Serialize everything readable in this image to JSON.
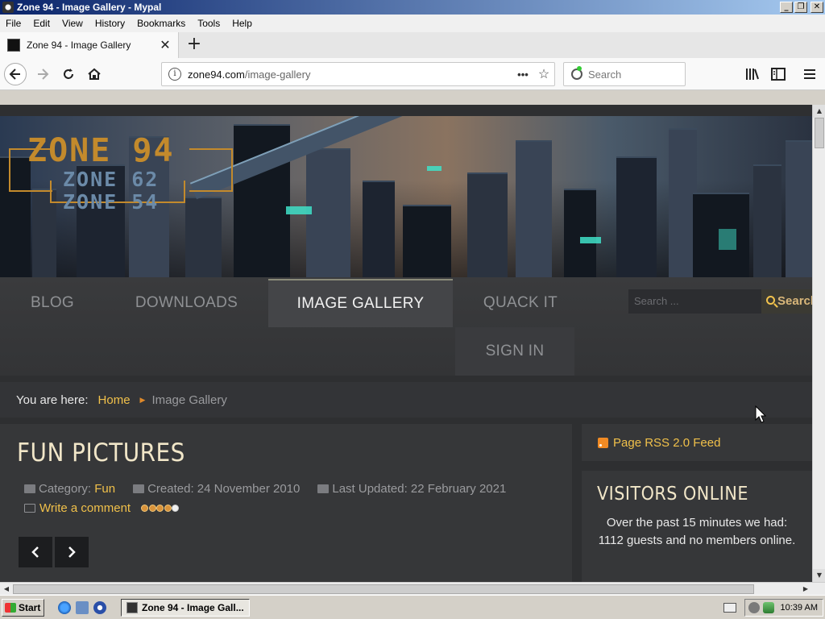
{
  "window": {
    "title": "Zone 94 - Image Gallery - Mypal",
    "buttons": [
      "_",
      "❐",
      "✕"
    ]
  },
  "menubar": {
    "items": [
      "File",
      "Edit",
      "View",
      "History",
      "Bookmarks",
      "Tools",
      "Help"
    ]
  },
  "tabs": {
    "active_title": "Zone 94 - Image Gallery",
    "close_glyph": "✕",
    "new_tab_glyph": "+"
  },
  "toolbar": {
    "url_host": "zone94.com",
    "url_path": "/image-gallery",
    "page_actions_glyph": "•••",
    "bookmark_glyph": "☆",
    "search_placeholder": "Search"
  },
  "site": {
    "logo": {
      "main": "ZONE 94",
      "sub1": "ZONE 62",
      "sub2": "ZONE 54"
    },
    "nav": {
      "items": [
        "BLOG",
        "DOWNLOADS",
        "IMAGE GALLERY",
        "QUACK IT",
        "SIGN IN"
      ],
      "active": "IMAGE GALLERY",
      "search_placeholder": "Search ...",
      "search_button": "Search"
    },
    "breadcrumb": {
      "label": "You are here:",
      "home": "Home",
      "current": "Image Gallery"
    },
    "article": {
      "title": "FUN PICTURES",
      "category_label": "Category:",
      "category_value": "Fun",
      "created": "Created: 24 November 2010",
      "updated": "Last Updated: 22 February 2021",
      "comment_link": "Write a comment",
      "rating": 4,
      "rating_max": 5,
      "prev_glyph": "‹",
      "next_glyph": "›"
    },
    "sidebar": {
      "rss_link": "Page RSS 2.0 Feed",
      "visitors_title": "VISITORS ONLINE",
      "visitors_text": "Over the past 15 minutes we had: 1112 guests and no members online."
    }
  },
  "taskbar": {
    "start_label": "Start",
    "task_label": "Zone 94 - Image Gall...",
    "clock": "10:39 AM"
  },
  "colors": {
    "accent_gold": "#f0c04a",
    "title_cream": "#f1e6c8",
    "page_bg": "#2e2f31",
    "logo_orange": "#c38a2c"
  }
}
